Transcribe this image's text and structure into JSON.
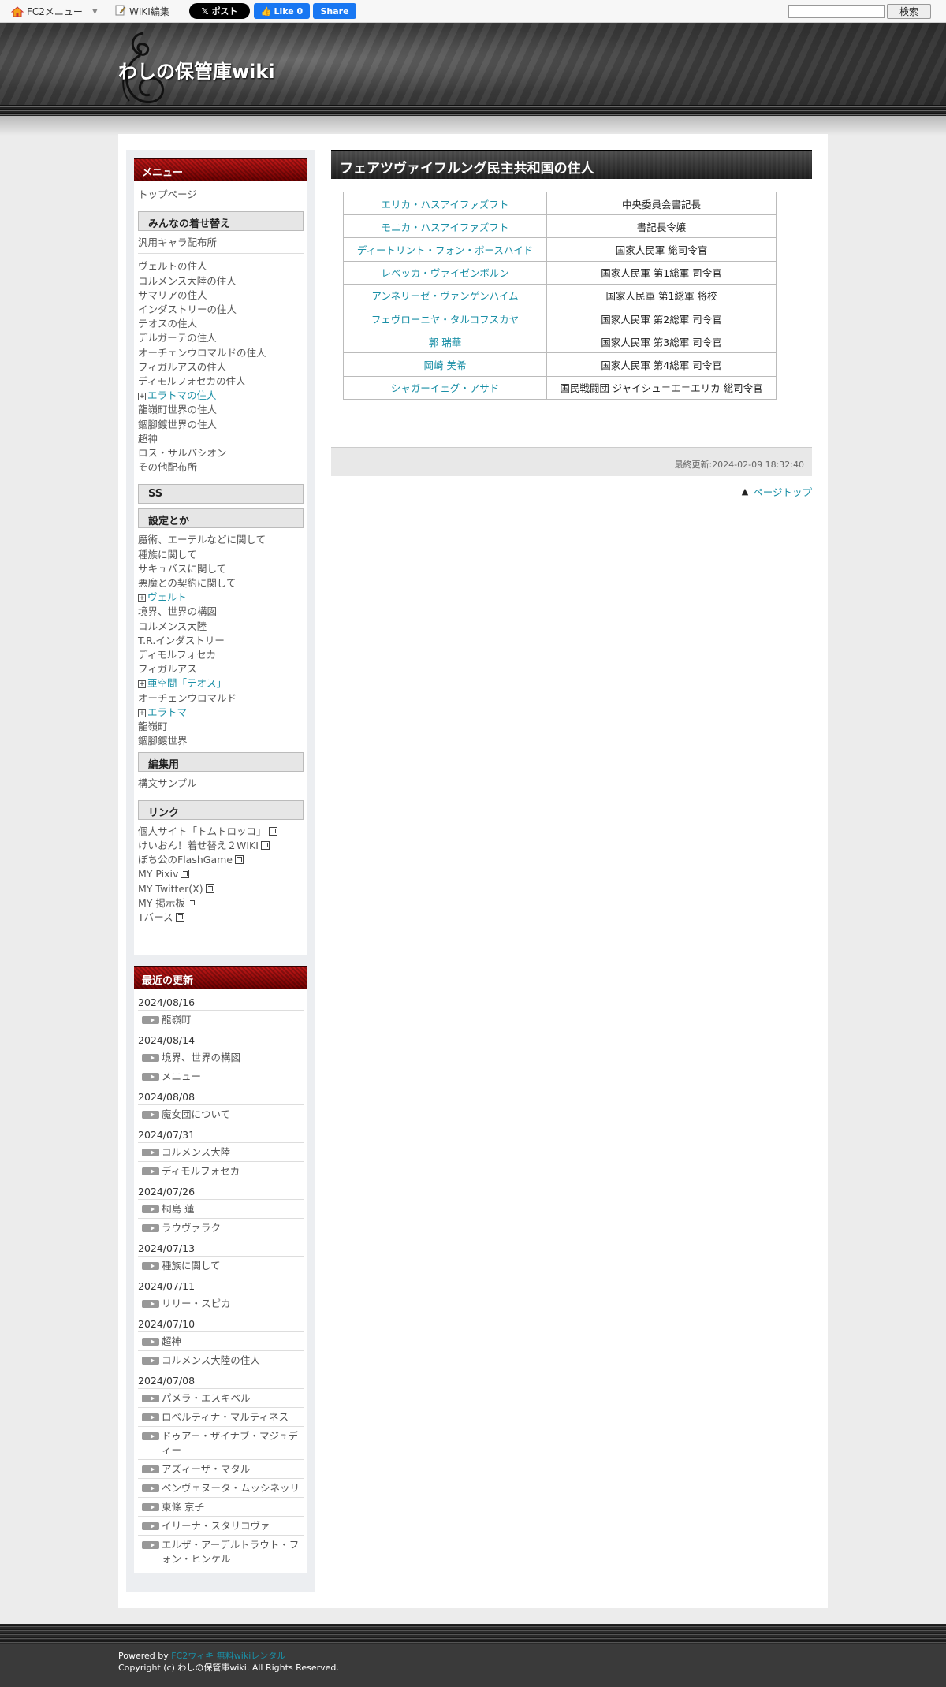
{
  "fc2bar": {
    "menu_label": "FC2メニュー",
    "wiki_edit_label": "WIKI編集",
    "x_post_label": "ポスト",
    "fb_like_label": "Like 0",
    "fb_share_label": "Share",
    "search_value": "",
    "search_button": "検索"
  },
  "header": {
    "site_title": "わしの保管庫wiki"
  },
  "sidebar": {
    "menu_title": "メニュー",
    "top_page": "トップページ",
    "section_dressup": "みんなの着せ替え",
    "generic_chars": "汎用キャラ配布所",
    "dressup_items": [
      {
        "label": "ヴェルトの住人",
        "expandable": false
      },
      {
        "label": "コルメンス大陸の住人",
        "expandable": false
      },
      {
        "label": "サマリアの住人",
        "expandable": false
      },
      {
        "label": "インダストリーの住人",
        "expandable": false
      },
      {
        "label": "テオスの住人",
        "expandable": false
      },
      {
        "label": "デルガーテの住人",
        "expandable": false
      },
      {
        "label": "オーチェンウロマルドの住人",
        "expandable": false
      },
      {
        "label": "フィガルアスの住人",
        "expandable": false
      },
      {
        "label": "ディモルフォセカの住人",
        "expandable": false
      },
      {
        "label": "エラトマの住人",
        "expandable": true
      },
      {
        "label": "龍嶺町世界の住人",
        "expandable": false
      },
      {
        "label": "錮腳鍍世界の住人",
        "expandable": false
      },
      {
        "label": "超神",
        "expandable": false
      },
      {
        "label": "ロス・サルバシオン",
        "expandable": false
      },
      {
        "label": "その他配布所",
        "expandable": false
      }
    ],
    "section_ss": "SS",
    "section_settings": "設定とか",
    "settings_items": [
      {
        "label": "魔術、エーテルなどに関して",
        "expandable": false
      },
      {
        "label": "種族に関して",
        "expandable": false
      },
      {
        "label": "サキュバスに関して",
        "expandable": false
      },
      {
        "label": "悪魔との契約に関して",
        "expandable": false
      },
      {
        "label": "ヴェルト",
        "expandable": true
      },
      {
        "label": "境界、世界の構図",
        "expandable": false
      },
      {
        "label": "コルメンス大陸",
        "expandable": false
      },
      {
        "label": "T.R.インダストリー",
        "expandable": false
      },
      {
        "label": "ディモルフォセカ",
        "expandable": false
      },
      {
        "label": "フィガルアス",
        "expandable": false
      },
      {
        "label": "亜空間「テオス」",
        "expandable": true
      },
      {
        "label": "オーチェンウロマルド",
        "expandable": false
      },
      {
        "label": "エラトマ",
        "expandable": true
      },
      {
        "label": "龍嶺町",
        "expandable": false
      },
      {
        "label": "錮腳鍍世界",
        "expandable": false
      }
    ],
    "section_edit": "編集用",
    "syntax_sample": "構文サンプル",
    "section_links": "リンク",
    "links": [
      "個人サイト「トムトロッコ」",
      "けいおん！着せ替え２WIKI",
      "ぽち公のFlashGame",
      "MY Pixiv",
      "MY Twitter(X)",
      "MY 掲示板",
      "Tバース"
    ],
    "recent_title": "最近の更新",
    "recent": [
      {
        "date": "2024/08/16",
        "items": [
          "龍嶺町"
        ]
      },
      {
        "date": "2024/08/14",
        "items": [
          "境界、世界の構図",
          "メニュー"
        ]
      },
      {
        "date": "2024/08/08",
        "items": [
          "魔女団について"
        ]
      },
      {
        "date": "2024/07/31",
        "items": [
          "コルメンス大陸",
          "ディモルフォセカ"
        ]
      },
      {
        "date": "2024/07/26",
        "items": [
          "桐島 蓮",
          "ラウヴァラク"
        ]
      },
      {
        "date": "2024/07/13",
        "items": [
          "種族に関して"
        ]
      },
      {
        "date": "2024/07/11",
        "items": [
          "リリー・スピカ"
        ]
      },
      {
        "date": "2024/07/10",
        "items": [
          "超神",
          "コルメンス大陸の住人"
        ]
      },
      {
        "date": "2024/07/08",
        "items": [
          "パメラ・エスキベル",
          "ロベルティナ・マルティネス",
          "ドゥアー・ザイナブ・マジュディー",
          "アズィーザ・マタル",
          "ベンヴェヌータ・ムッシネッリ",
          "東條 京子",
          "イリーナ・スタリコヴァ",
          "エルザ・アーデルトラウト・フォン・ヒンケル"
        ]
      }
    ]
  },
  "main": {
    "title": "フェアツヴァイフルング民主共和国の住人",
    "rows": [
      {
        "name": "エリカ・ハスアイファズフト",
        "role": "中央委員会書記長"
      },
      {
        "name": "モニカ・ハスアイファズフト",
        "role": "書記長令嬢"
      },
      {
        "name": "ディートリント・フォン・ボースハイド",
        "role": "国家人民軍 総司令官"
      },
      {
        "name": "レベッカ・ヴァイゼンボルン",
        "role": "国家人民軍 第1総軍 司令官"
      },
      {
        "name": "アンネリーゼ・ヴァンゲンハイム",
        "role": "国家人民軍 第1総軍 将校"
      },
      {
        "name": "フェヴローニヤ・タルコフスカヤ",
        "role": "国家人民軍 第2総軍 司令官"
      },
      {
        "name": "郭 瑞華",
        "role": "国家人民軍 第3総軍 司令官"
      },
      {
        "name": "岡崎 美希",
        "role": "国家人民軍 第4総軍 司令官"
      },
      {
        "name": "シャガーイェグ・アサド",
        "role": "国民戦闘団 ジャイシュ＝エ＝エリカ 総司令官"
      }
    ],
    "last_modified": "最終更新:2024-02-09 18:32:40",
    "page_top": "ページトップ"
  },
  "footer": {
    "powered_prefix": "Powered by ",
    "powered_link": "FC2ウィキ 無料wikiレンタル",
    "copyright": "Copyright (c) わしの保管庫wiki. All Rights Reserved."
  }
}
